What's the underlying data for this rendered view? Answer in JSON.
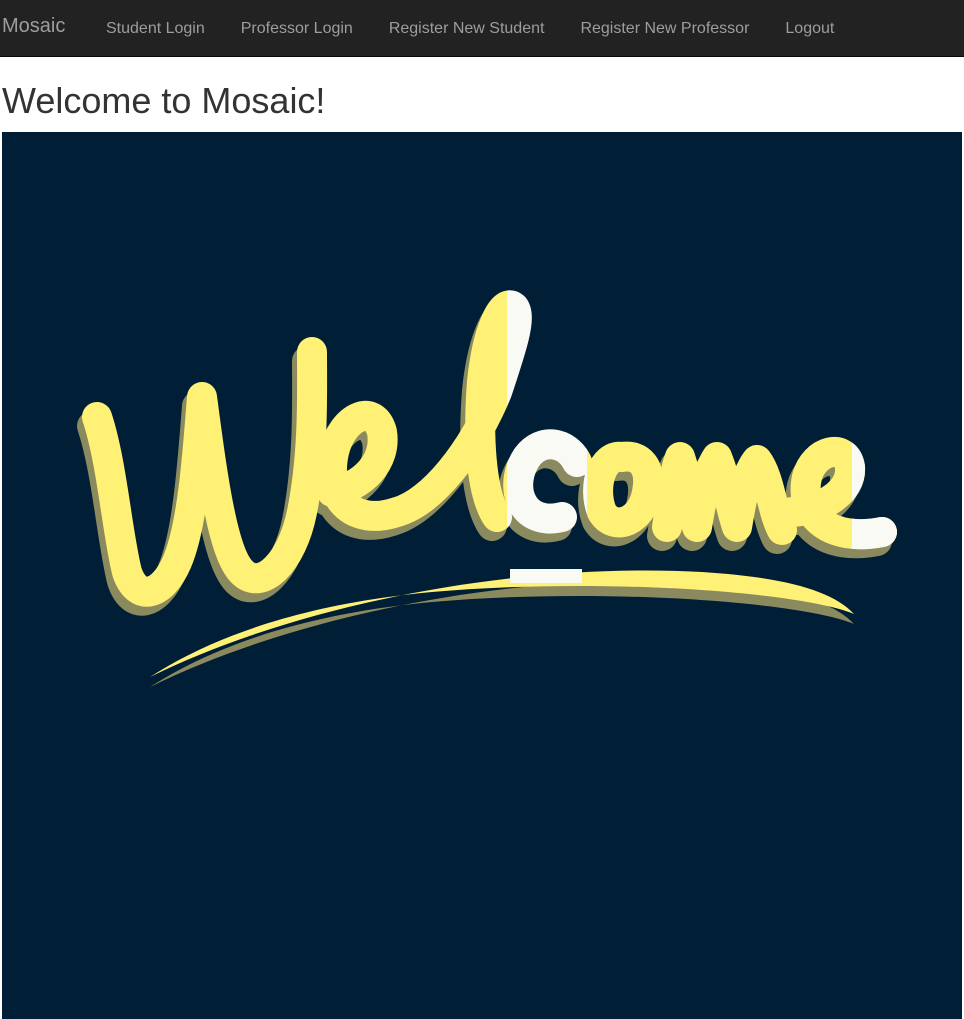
{
  "navbar": {
    "brand": "Mosaic",
    "links": [
      {
        "label": "Student Login"
      },
      {
        "label": "Professor Login"
      },
      {
        "label": "Register New Student"
      },
      {
        "label": "Register New Professor"
      },
      {
        "label": "Logout"
      }
    ]
  },
  "main": {
    "title": "Welcome to Mosaic!",
    "image": {
      "lettering": "Welcome",
      "colors": {
        "background": "#001e36",
        "primary": "#fff176",
        "accent": "#fafaf5",
        "shadow": "#8a8a5e"
      }
    }
  }
}
